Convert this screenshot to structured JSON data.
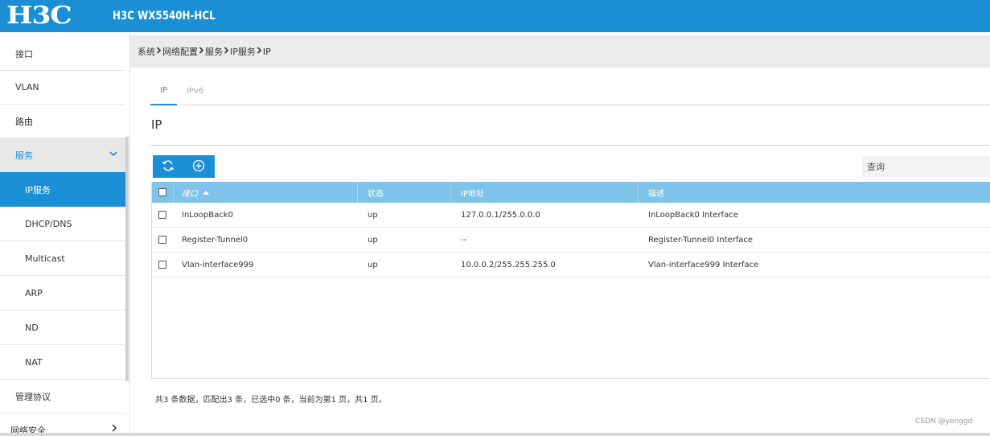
{
  "header": {
    "logo": "H3C",
    "title": "H3C WX5540H-HCL"
  },
  "sidebar": {
    "items": [
      {
        "label": "接口"
      },
      {
        "label": "VLAN"
      },
      {
        "label": "路由"
      },
      {
        "label": "服务"
      },
      {
        "label": "IP服务"
      },
      {
        "label": "DHCP/DNS"
      },
      {
        "label": "Multicast"
      },
      {
        "label": "ARP"
      },
      {
        "label": "ND"
      },
      {
        "label": "NAT"
      },
      {
        "label": "管理协议"
      },
      {
        "label": "网络安全"
      }
    ]
  },
  "breadcrumb": [
    "系统",
    "网络配置",
    "服务",
    "IP服务",
    "IP"
  ],
  "tabs": [
    {
      "label": "IP"
    },
    {
      "label": "IPv6"
    }
  ],
  "section": {
    "title": "IP"
  },
  "search": {
    "placeholder": "查询"
  },
  "table": {
    "columns": [
      "接口",
      "状态",
      "IP地址",
      "描述"
    ],
    "rows": [
      [
        "InLoopBack0",
        "up",
        "127.0.0.1/255.0.0.0",
        "InLoopBack0 Interface"
      ],
      [
        "Register-Tunnel0",
        "up",
        "--",
        "Register-Tunnel0 Interface"
      ],
      [
        "Vlan-interface999",
        "up",
        "10.0.0.2/255.255.255.0",
        "Vlan-interface999 Interface"
      ]
    ]
  },
  "summary": "共3 条数据，匹配出3 条，已选中0 条，当前为第1 页，共1 页。",
  "watermark": "CSDN @yenggd",
  "colors": {
    "accent": "#1a8fd6",
    "table_header": "#7fc4e8"
  }
}
